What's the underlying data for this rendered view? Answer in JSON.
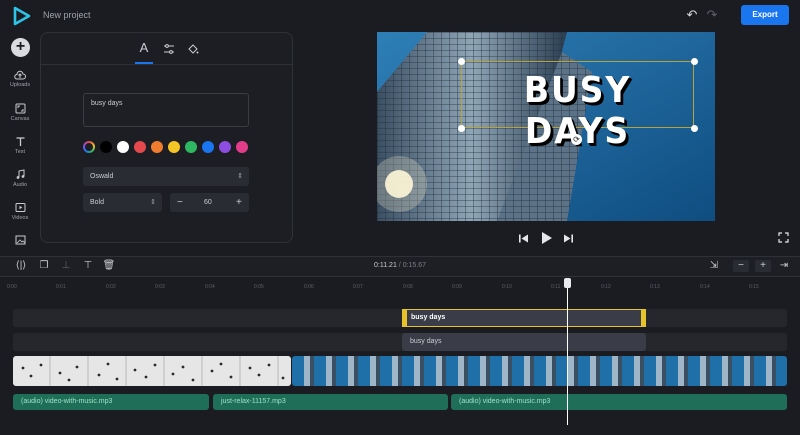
{
  "header": {
    "project_title": "New project",
    "export_label": "Export"
  },
  "rail": {
    "items": [
      {
        "label": "Uploads",
        "icon": "cloud-upload-icon"
      },
      {
        "label": "Canvas",
        "icon": "canvas-icon"
      },
      {
        "label": "Text",
        "icon": "text-icon"
      },
      {
        "label": "Audio",
        "icon": "music-note-icon"
      },
      {
        "label": "Videos",
        "icon": "video-icon"
      },
      {
        "label": "",
        "icon": "image-icon"
      }
    ]
  },
  "text_panel": {
    "tabs": [
      "text-tab",
      "adjust-tab",
      "fill-tab"
    ],
    "text_value": "busy days",
    "colors": [
      "#000000",
      "#ffffff",
      "#e5484d",
      "#f07d2f",
      "#f5c425",
      "#2fb862",
      "#1a76ee",
      "#8c4de0",
      "#e23d8a"
    ],
    "font_family": "Oswald",
    "font_weight": "Bold",
    "font_size": "60"
  },
  "preview": {
    "caption": "BUSY DAYS"
  },
  "timeline": {
    "current_time": "0:11.21",
    "separator": "/",
    "total_time": "0:15.67",
    "ruler": [
      "0:00",
      "0:01",
      "0:02",
      "0:03",
      "0:04",
      "0:05",
      "0:06",
      "0:07",
      "0:08",
      "0:09",
      "0:10",
      "0:11",
      "0:12",
      "0:13",
      "0:14",
      "0:15"
    ],
    "text_clip_selected": "busy days",
    "text_clip": "busy days",
    "audio_clips": [
      "(audio) video-with-music.mp3",
      "just-relax-11157.mp3",
      "(audio) video-with-music.mp3"
    ]
  }
}
